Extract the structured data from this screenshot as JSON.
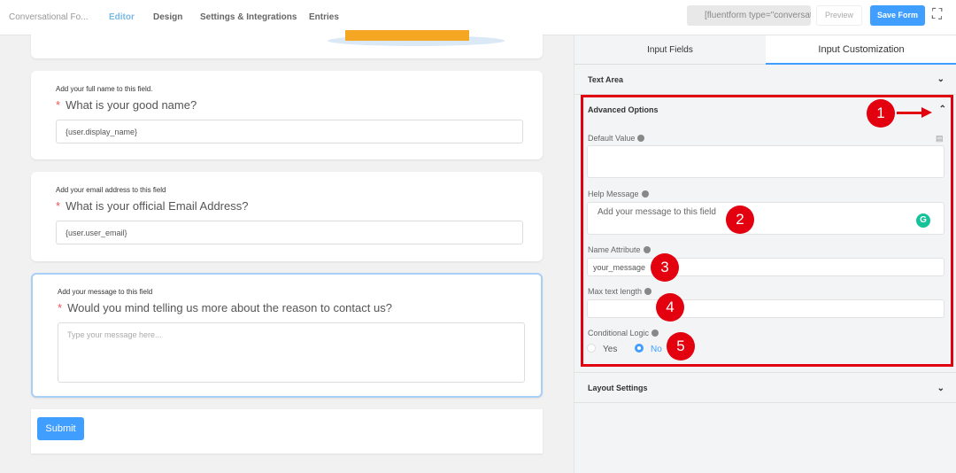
{
  "header": {
    "breadcrumb": "Conversational Fo...",
    "tabs": [
      "Editor",
      "Design",
      "Settings & Integrations",
      "Entries"
    ],
    "shortcode": "[fluentform type=\"conversational\"",
    "preview": "Preview",
    "save": "Save Form"
  },
  "form": {
    "fields": [
      {
        "help": "Add your full name to this field.",
        "question": "What is your good name?",
        "value": "{user.display_name}"
      },
      {
        "help": "Add your email address to this field",
        "question": "What is your official Email Address?",
        "value": "{user.user_email}"
      },
      {
        "help": "Add your message to this field",
        "question": "Would you mind telling us more about the reason to contact us?",
        "placeholder": "Type your message here..."
      }
    ],
    "required_mark": "*",
    "submit": "Submit"
  },
  "panel": {
    "tabs": [
      "Input Fields",
      "Input Customization"
    ],
    "text_area": "Text Area",
    "advanced": "Advanced Options",
    "default_value": "Default Value",
    "help_message": "Help Message",
    "help_value": "Add your message to this field",
    "name_attribute": "Name Attribute",
    "name_value": "your_message",
    "max_length": "Max text length",
    "conditional": "Conditional Logic",
    "yes": "Yes",
    "no": "No",
    "conditional_selected": "No",
    "layout": "Layout Settings"
  },
  "annotations": [
    "1",
    "2",
    "3",
    "4",
    "5"
  ],
  "colors": {
    "accent": "#409eff",
    "annotation": "#e3000f"
  }
}
